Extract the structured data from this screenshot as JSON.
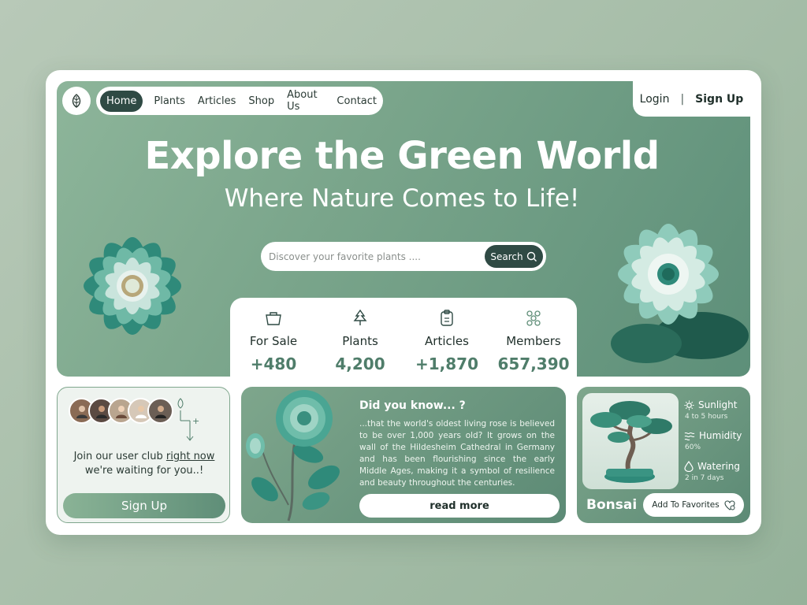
{
  "nav": {
    "items": [
      "Home",
      "Plants",
      "Articles",
      "Shop",
      "About Us",
      "Contact"
    ],
    "active": "Home",
    "login": "Login",
    "separator": "|",
    "signup": "Sign Up"
  },
  "hero": {
    "title": "Explore the Green World",
    "subtitle": "Where Nature Comes to Life!"
  },
  "search": {
    "placeholder": "Discover your favorite plants ....",
    "button": "Search"
  },
  "stats": [
    {
      "label": "For Sale",
      "value": "+480",
      "icon": "basket-icon"
    },
    {
      "label": "Plants",
      "value": "4,200",
      "icon": "tree-icon"
    },
    {
      "label": "Articles",
      "value": "+1,870",
      "icon": "clipboard-icon"
    },
    {
      "label": "Members",
      "value": "657,390",
      "icon": "members-icon"
    }
  ],
  "club": {
    "text_before": "Join our user club ",
    "link": "right now",
    "text_after": "we're waiting for you..!",
    "button": "Sign Up",
    "plus": "+"
  },
  "did_you_know": {
    "title": "Did you know... ?",
    "body": "...that the world's oldest living rose is believed to be over 1,000 years old? It grows on the wall of the Hildesheim Cathedral in Germany and has been flourishing since the early Middle Ages, making it a symbol of resilience and beauty throughout the centuries.",
    "button": "read more"
  },
  "plant": {
    "name": "Bonsai",
    "favorite_button": "Add To Favorites",
    "care": [
      {
        "title": "Sunlight",
        "detail": "4 to 5 hours",
        "icon": "sun-icon"
      },
      {
        "title": "Humidity",
        "detail": "60%",
        "icon": "humidity-icon"
      },
      {
        "title": "Watering",
        "detail": "2 in 7 days",
        "icon": "water-drop-icon"
      }
    ]
  },
  "colors": {
    "accent_dark": "#2f4a44",
    "green_primary": "#7aa58b",
    "stat_value": "#4f7d6a"
  }
}
